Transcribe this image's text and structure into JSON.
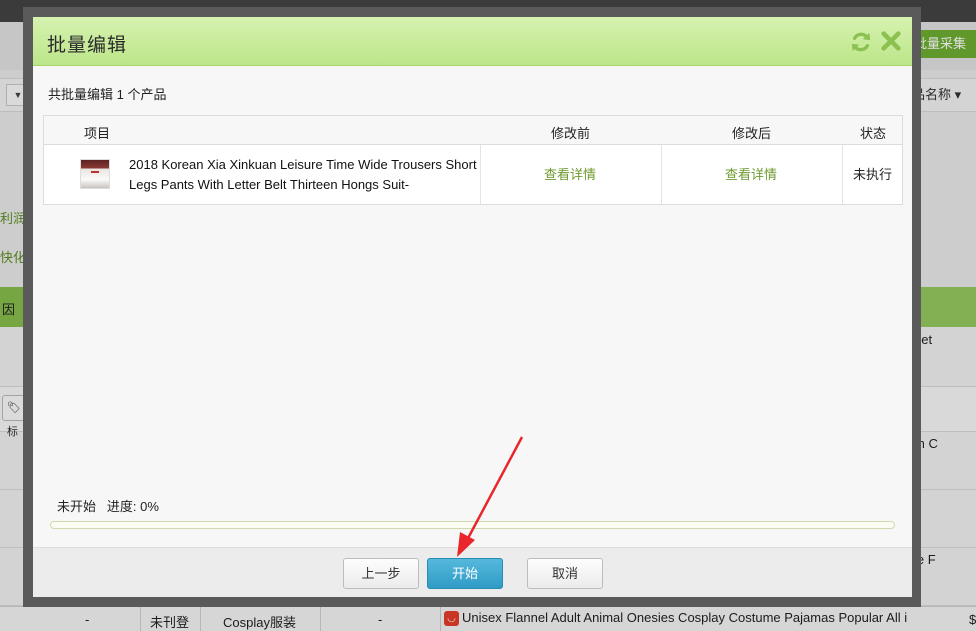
{
  "background": {
    "batch_collect_button": "批量采集",
    "toolbar_dropdown_right": "品名称",
    "profit_link": "利润区",
    "quick_link": "快化详",
    "table_head_reason": "因",
    "row_text_1": "Let",
    "row_text_2": "m C",
    "row_text_3": "le F",
    "tag_button_label": "标",
    "bottom_row": {
      "col_dash_1": "-",
      "status": "未刊登",
      "category": "Cosplay服装",
      "col_dash_2": "-",
      "product_title": "Unisex  Flannel Adult Animal Onesies Cosplay Costume Pajamas Popular All i",
      "price_prefix": "$"
    },
    "colors": {
      "accent_green": "#86be4a",
      "batch_button": "#6fae33"
    }
  },
  "modal": {
    "title": "批量编辑",
    "icons": {
      "refresh": "refresh-icon",
      "close": "close-icon"
    },
    "summary": "共批量编辑 1 个产品",
    "table": {
      "headers": {
        "item": "项目",
        "before": "修改前",
        "after": "修改后",
        "status": "状态"
      },
      "rows": [
        {
          "product_name": "2018 Korean Xia Xinkuan Leisure Time Wide Trousers Short Legs Pants With Letter Belt Thirteen Hongs Suit-",
          "before_link": "查看详情",
          "after_link": "查看详情",
          "status": "未执行"
        }
      ]
    },
    "progress": {
      "state": "未开始",
      "label": "进度:",
      "percent_text": "0%",
      "value": 0
    },
    "footer": {
      "prev_label": "上一步",
      "start_label": "开始",
      "cancel_label": "取消"
    },
    "colors": {
      "header_green": "#c8eb9c",
      "primary_button": "#3aa6d0",
      "link_green": "#6f9a2f"
    }
  }
}
